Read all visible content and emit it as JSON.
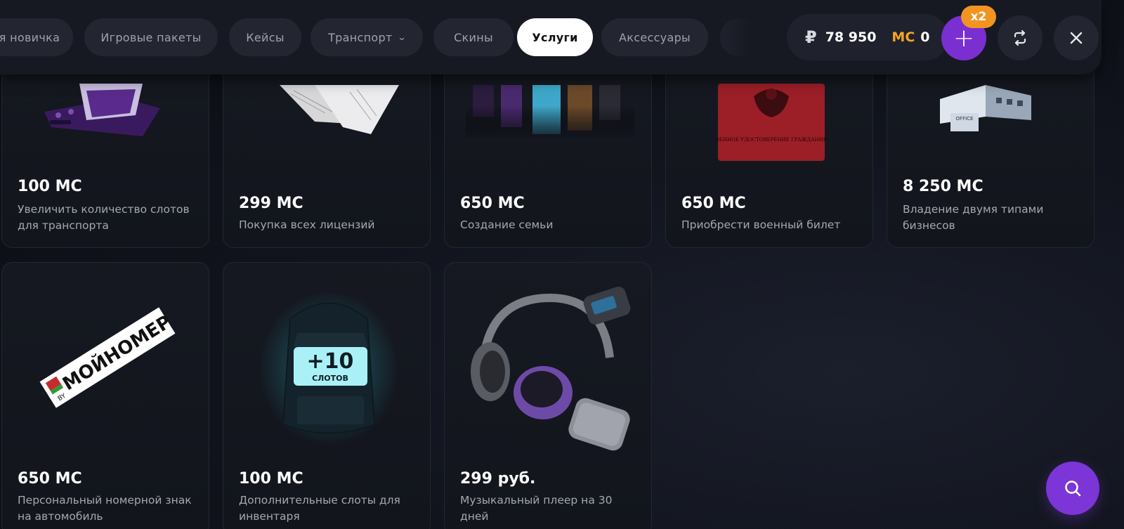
{
  "tabs": [
    {
      "label": "я новичка"
    },
    {
      "label": "Игровые пакеты"
    },
    {
      "label": "Кейсы"
    },
    {
      "label": "Транспорт",
      "chevron": "⌄"
    },
    {
      "label": "Скины"
    },
    {
      "label": "Услуги",
      "active": true
    },
    {
      "label": "Аксессуары"
    }
  ],
  "header": {
    "currency_icon": "₽",
    "rub_balance": "78 950",
    "ms_label": "MC",
    "ms_balance": "0",
    "plus_icon": "+",
    "multiplier_badge": "x2",
    "refresh_icon": "refresh-icon",
    "close_icon": "close-icon"
  },
  "cards": [
    {
      "price": "100 MC",
      "desc": "Увеличить количество слотов для транспорта",
      "icon": "garage-tablet-icon"
    },
    {
      "price": "299 MC",
      "desc": "Покупка всех лицензий",
      "icon": "documents-icon"
    },
    {
      "price": "650 MC",
      "desc": "Создание семьи",
      "icon": "family-icon"
    },
    {
      "price": "650 MC",
      "desc": "Приобрести военный билет",
      "icon": "military-id-icon",
      "doc_text": "ВОЕННОЕ УДОСТОВЕРЕНИЕ ГРАЖДАНИНА"
    },
    {
      "price": "8 250 MC",
      "desc": "Владение двумя типами бизнесов",
      "icon": "office-building-icon",
      "sign_text": "OFFICE"
    },
    {
      "price": "650 MC",
      "desc": "Персональный номерной знак на автомобиль",
      "icon": "license-plate-icon",
      "plate_text": "МОЙНОМЕР",
      "plate_country": "BY"
    },
    {
      "price": "100 MC",
      "desc": "Дополнительные слоты для инвентаря",
      "icon": "backpack-icon",
      "badge_big": "+10",
      "badge_small": "СЛОТОВ"
    },
    {
      "price": "299 руб.",
      "desc": "Музыкальный плеер на 30 дней",
      "icon": "headphones-player-icon"
    }
  ],
  "search_fab": {
    "icon": "search-icon"
  },
  "colors": {
    "accent_purple": "#7a2fd1",
    "accent_orange": "#f29422",
    "ms_gold": "#f5a623"
  }
}
